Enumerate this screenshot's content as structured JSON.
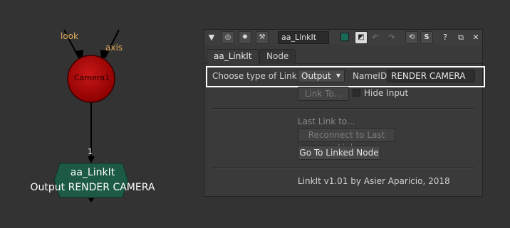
{
  "graph": {
    "camera_node": {
      "label": "Camera1",
      "inputs": [
        "look",
        "axis"
      ]
    },
    "pipe_number": "1",
    "link_node": {
      "title": "aa_LinkIt",
      "subtitle": "Output RENDER CAMERA"
    }
  },
  "panel": {
    "toolbar": {
      "node_name": "aa_LinkIt",
      "help_label": "?",
      "close_label": "✕",
      "float_label": "⧉",
      "s_label": "S"
    },
    "tabs": [
      {
        "label": "aa_LinkIt",
        "active": true
      },
      {
        "label": "Node",
        "active": false
      }
    ],
    "link_type_label": "Choose type of Link",
    "link_type_value": "Output",
    "name_id_label": "NameID",
    "name_id_value": "RENDER CAMERA",
    "link_to_button": "Link To...",
    "hide_input_label": "Hide Input",
    "hide_input_checked": false,
    "last_link_label": "Last Link to...",
    "reconnect_button": "Reconnect to Last Link",
    "goto_button": "Go To Linked Node",
    "footer": "LinkIt v1.01 by Asier Aparicio, 2018"
  },
  "colors": {
    "camera_fill": "#b30000",
    "link_node_fill": "#1c5a45",
    "tile_color_swatch": "#1a6a5a",
    "highlight": "#ffffff"
  }
}
